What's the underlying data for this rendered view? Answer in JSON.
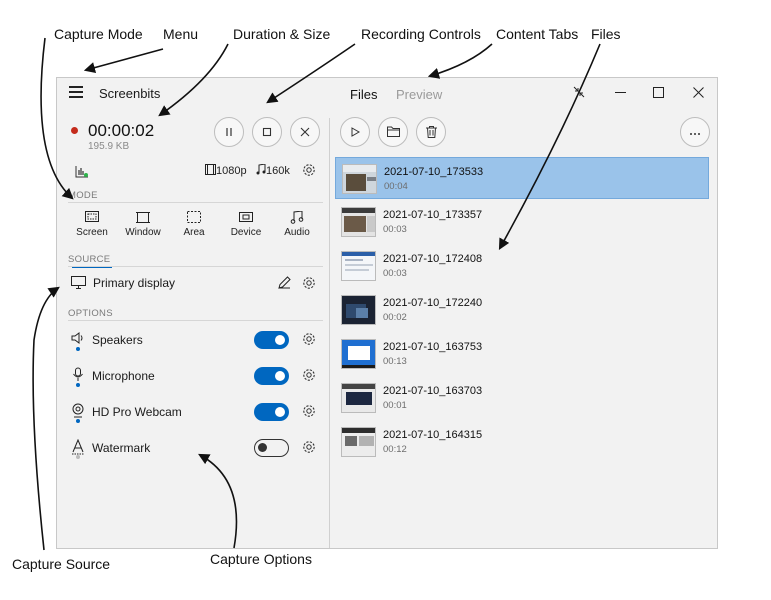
{
  "annotations": {
    "capture_mode": "Capture Mode",
    "menu": "Menu",
    "duration_size": "Duration & Size",
    "recording_controls": "Recording Controls",
    "content_tabs": "Content Tabs",
    "files": "Files",
    "capture_source": "Capture Source",
    "capture_options": "Capture Options"
  },
  "titlebar": {
    "app_title": "Screenbits",
    "tabs": [
      "Files",
      "Preview"
    ],
    "active_tab": "Files"
  },
  "recording": {
    "timer": "00:00:02",
    "size": "195.9 KB",
    "resolution": "1080p",
    "bitrate": "160k"
  },
  "mode": {
    "label": "MODE",
    "items": [
      "Screen",
      "Window",
      "Area",
      "Device",
      "Audio"
    ],
    "selected": "Screen"
  },
  "source": {
    "label": "SOURCE",
    "value": "Primary display"
  },
  "options": {
    "label": "OPTIONS",
    "items": [
      {
        "label": "Speakers",
        "on": true
      },
      {
        "label": "Microphone",
        "on": true
      },
      {
        "label": "HD Pro Webcam",
        "on": true
      },
      {
        "label": "Watermark",
        "on": false
      }
    ]
  },
  "files": [
    {
      "name": "2021-07-10_173533",
      "duration": "00:04",
      "selected": true
    },
    {
      "name": "2021-07-10_173357",
      "duration": "00:03"
    },
    {
      "name": "2021-07-10_172408",
      "duration": "00:03"
    },
    {
      "name": "2021-07-10_172240",
      "duration": "00:02"
    },
    {
      "name": "2021-07-10_163753",
      "duration": "00:13"
    },
    {
      "name": "2021-07-10_163703",
      "duration": "00:01"
    },
    {
      "name": "2021-07-10_164315",
      "duration": "00:12"
    }
  ],
  "colors": {
    "accent": "#0067c0",
    "record_red": "#c42b1c",
    "selection": "#9ac3ea"
  }
}
